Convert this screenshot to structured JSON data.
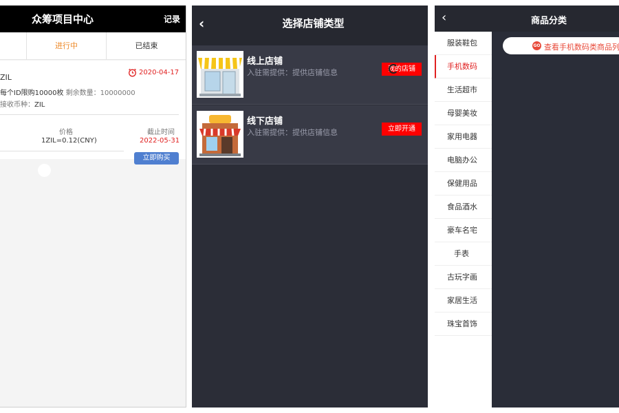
{
  "crowdfund": {
    "title": "众筹项目中心",
    "record_label": "记录",
    "tabs": [
      {
        "label": "进行中",
        "active": true
      },
      {
        "label": "已结束",
        "active": false
      }
    ],
    "item": {
      "name": "ZIL",
      "date": "2020-04-17",
      "limit": "每个ID限购10000枚",
      "remaining_label": "剩余数量：",
      "remaining_value": "10000000",
      "currency_label": "接收币种：",
      "currency_value": "ZIL",
      "price_label": "价格",
      "price_value": "1ZIL=0.12(CNY)",
      "deadline_label": "截止时间",
      "deadline_value": "2022-05-31",
      "buy_label": "立即购买"
    }
  },
  "shop_type": {
    "back_icon": "chevron-left-icon",
    "title": "选择店铺类型",
    "rows": [
      {
        "title": "线上店铺",
        "desc": "入驻需提供：提供店铺信息",
        "button": "我的店铺",
        "image": "online-store-image"
      },
      {
        "title": "线下店铺",
        "desc": "入驻需提供：提供店铺信息",
        "button": "立即开通",
        "image": "offline-store-image"
      }
    ]
  },
  "category": {
    "back_icon": "chevron-left-icon",
    "title": "商品分类",
    "items": [
      {
        "label": "服装鞋包",
        "active": false
      },
      {
        "label": "手机数码",
        "active": true
      },
      {
        "label": "生活超市",
        "active": false
      },
      {
        "label": "母婴美妆",
        "active": false
      },
      {
        "label": "家用电器",
        "active": false
      },
      {
        "label": "电脑办公",
        "active": false
      },
      {
        "label": "保健用品",
        "active": false
      },
      {
        "label": "食品酒水",
        "active": false
      },
      {
        "label": "豪车名宅",
        "active": false
      },
      {
        "label": "手表",
        "active": false
      },
      {
        "label": "古玩字画",
        "active": false
      },
      {
        "label": "家居生活",
        "active": false
      },
      {
        "label": "珠宝首饰",
        "active": false
      }
    ],
    "view_list_label": "查看手机数码类商品列",
    "view_list_icon_text": "GO"
  },
  "colors": {
    "accent_red": "#ff0000",
    "tab_orange": "#ee8a2a",
    "buy_blue": "#4f7fd0",
    "dark_bg": "#2b2d37"
  }
}
